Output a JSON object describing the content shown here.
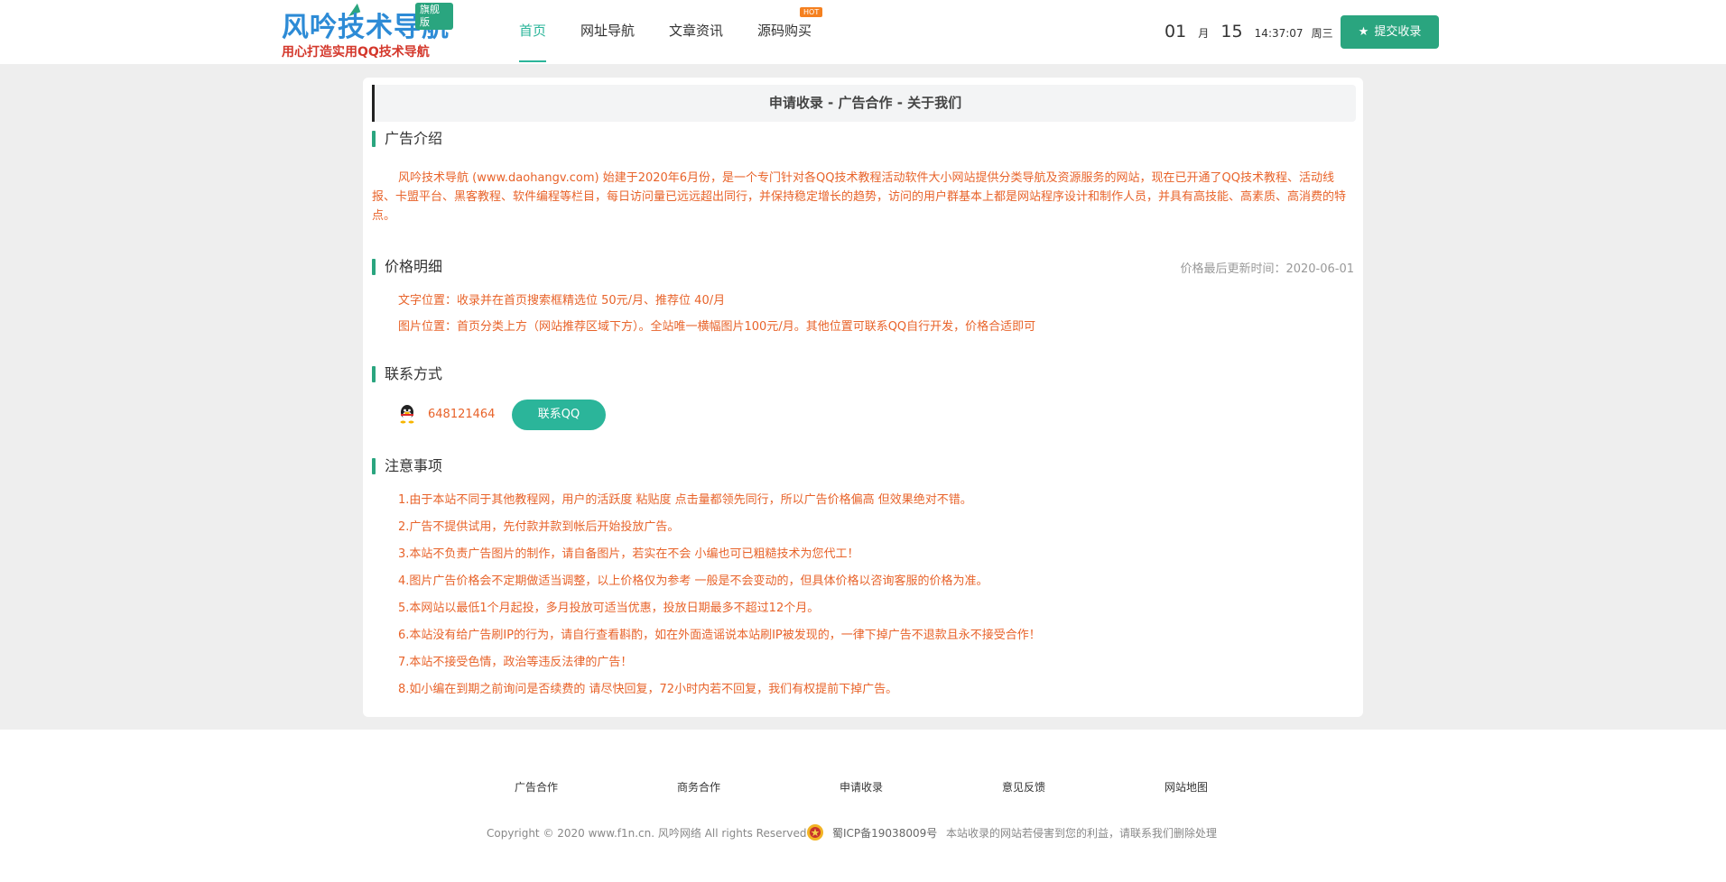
{
  "header": {
    "logo": {
      "title": "风吟技术导航",
      "badge": "旗舰版",
      "slogan": "用心打造实用QQ技术导航"
    },
    "nav": [
      {
        "label": "首页",
        "active": true
      },
      {
        "label": "网址导航"
      },
      {
        "label": "文章资讯"
      },
      {
        "label": "源码购买",
        "badge": "HOT"
      }
    ],
    "date": {
      "month": "01",
      "month_unit": "月",
      "day": "15",
      "time": "14:37:07",
      "weekday": "周三"
    },
    "submit_button": {
      "label": "提交收录",
      "icon": "star-icon"
    }
  },
  "card": {
    "top_links": "申请收录 - 广告合作 - 关于我们",
    "ad_intro": {
      "title": "广告介绍",
      "text": "风吟技术导航 (www.daohangv.com) 始建于2020年6月份，是一个专门针对各QQ技术教程活动软件大小网站提供分类导航及资源服务的网站，现在已开通了QQ技术教程、活动线报、卡盟平台、黑客教程、软件编程等栏目，每日访问量已远远超出同行，并保持稳定增长的趋势，访问的用户群基本上都是网站程序设计和制作人员，并具有高技能、高素质、高消费的特点。"
    },
    "price": {
      "title": "价格明细",
      "updated": "价格最后更新时间：2020-06-01",
      "lines": [
        "文字位置：收录并在首页搜索框精选位 50元/月、推荐位 40/月",
        "图片位置：首页分类上方（网站推荐区域下方）。全站唯一横幅图片100元/月。其他位置可联系QQ自行开发，价格合适即可"
      ]
    },
    "contact": {
      "title": "联系方式",
      "qq_number": "648121464",
      "qq_button": "联系QQ"
    },
    "notice": {
      "title": "注意事项",
      "items": [
        "1.由于本站不同于其他教程网，用户的活跃度 粘贴度 点击量都领先同行，所以广告价格偏高 但效果绝对不错。",
        "2.广告不提供试用，先付款并款到帐后开始投放广告。",
        "3.本站不负责广告图片的制作，请自备图片，若实在不会 小编也可已粗糙技术为您代工！",
        "4.图片广告价格会不定期做适当调整，以上价格仅为参考 一般是不会变动的，但具体价格以咨询客服的价格为准。",
        "5.本网站以最低1个月起投，多月投放可适当优惠，投放日期最多不超过12个月。",
        "6.本站没有给广告刷IP的行为，请自行查看斟酌，如在外面造谣说本站刷IP被发现的，一律下掉广告不退款且永不接受合作！",
        "7.本站不接受色情，政治等违反法律的广告！",
        "8.如小编在到期之前询问是否续费的 请尽快回复，72小时内若不回复，我们有权提前下掉广告。"
      ]
    }
  },
  "footer": {
    "links": [
      "广告合作",
      "商务合作",
      "申请收录",
      "意见反馈",
      "网站地图"
    ],
    "copyright": "Copyright © 2020 www.f1n.cn. 风吟网络 All rights Reserved",
    "icp": "蜀ICP备19038009号",
    "disclaimer": "本站收录的网站若侵害到您的利益，请联系我们删除处理"
  },
  "colors": {
    "accent": "#2aa57f",
    "accent_light": "#2bb59a",
    "orange_text": "#e8632a",
    "hot_badge": "#f5801f",
    "band_bg": "#eeeeee"
  }
}
